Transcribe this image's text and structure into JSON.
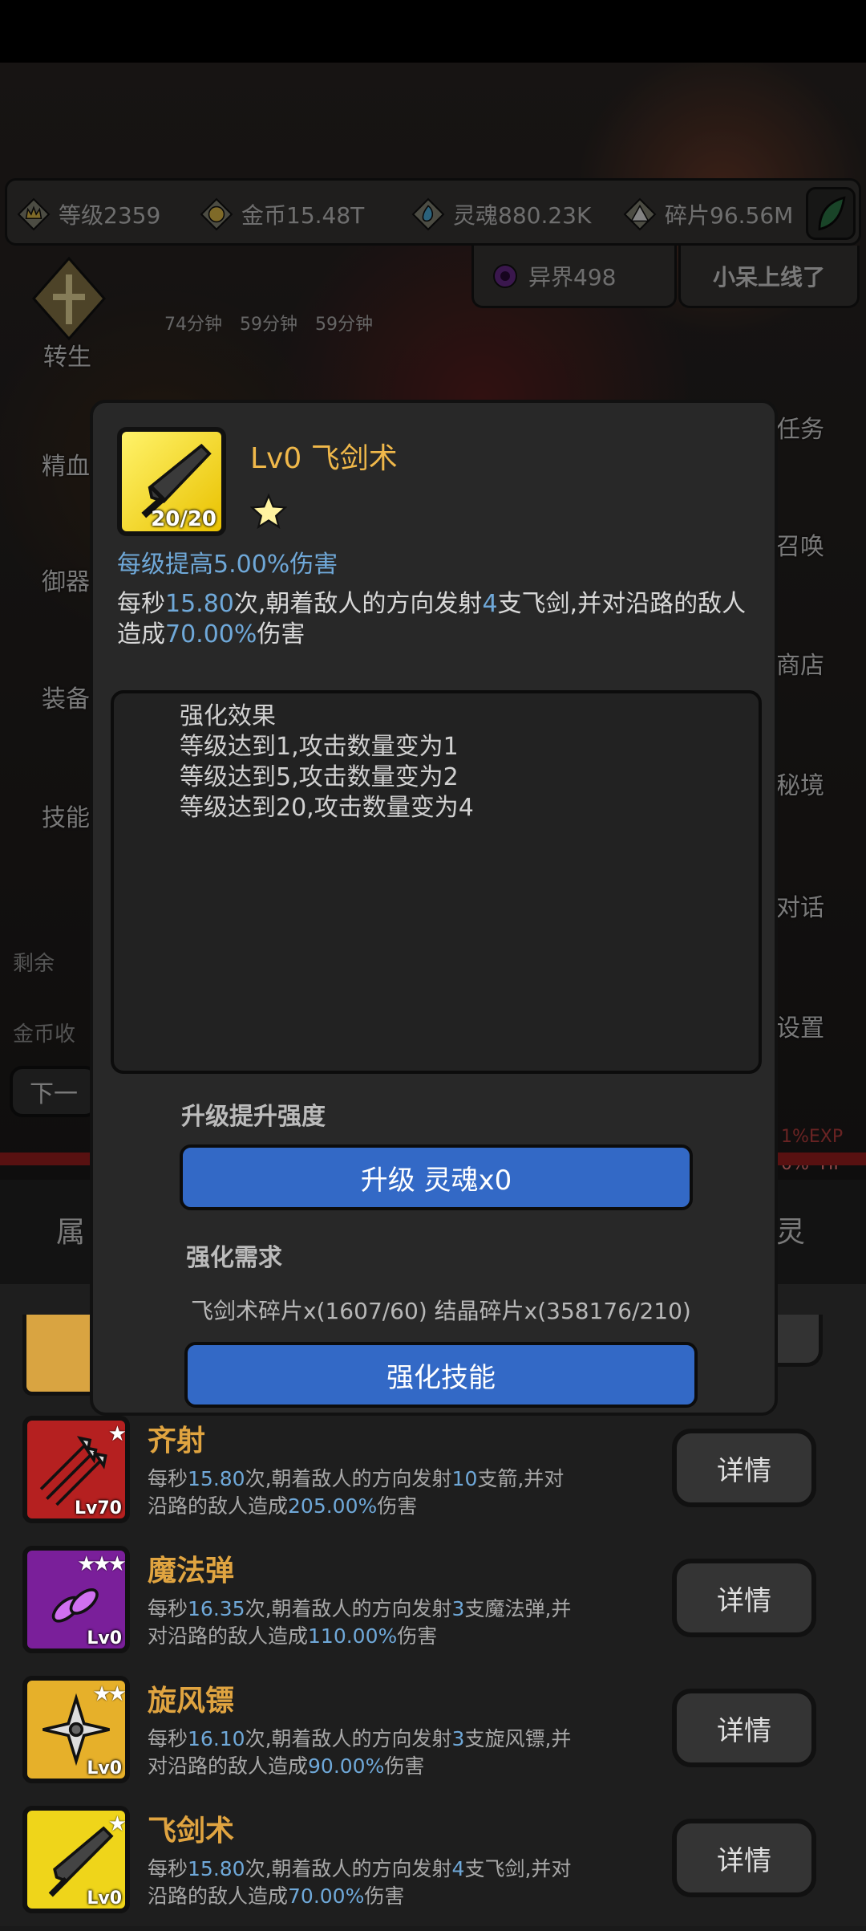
{
  "resources": {
    "level": "等级2359",
    "gold": "金币15.48T",
    "soul": "灵魂880.23K",
    "shards": "碎片96.56M",
    "otherworld": "异界498",
    "online": "小呆上线了"
  },
  "timers": [
    "74分钟",
    "59分钟",
    "59分钟"
  ],
  "left_menu": [
    "转生",
    "精血",
    "御器",
    "装备",
    "技能"
  ],
  "right_menu": [
    "任务",
    "召唤",
    "商店",
    "秘境",
    "对话",
    "设置"
  ],
  "left_info": [
    "剩余",
    "金币收"
  ],
  "next_button": "下一",
  "hud": {
    "exp": "1%EXP",
    "hp": "0%  HP"
  },
  "modal": {
    "title": "Lv0 飞剑术",
    "icon_count": "20/20",
    "growth": "每级提高5.00%伤害",
    "desc_parts": [
      "每秒",
      "15.80",
      "次,朝着敌人的方向发射",
      "4",
      "支飞剑,并对沿路的敌人造成",
      "70.00%",
      "伤害"
    ],
    "effect_title": "强化效果",
    "effects": [
      "等级达到1,攻击数量变为1",
      "等级达到5,攻击数量变为2",
      "等级达到20,攻击数量变为4"
    ],
    "upgrade_label": "升级提升强度",
    "upgrade_button": "升级 灵魂x0",
    "req_label": "强化需求",
    "req_text": "飞剑术碎片x(1607/60) 结晶碎片x(358176/210)",
    "enhance_button": "强化技能"
  },
  "tabs": {
    "left": "属",
    "right": "灵"
  },
  "skills": [
    {
      "name": "齐射",
      "level": "Lv70",
      "stars": "★",
      "desc": [
        "每秒",
        "15.80",
        "次,朝着敌人的方向发射",
        "10",
        "支箭,并对沿路的敌人造成",
        "205.00%",
        "伤害"
      ],
      "button": "详情",
      "color": "#b52020"
    },
    {
      "name": "魔法弹",
      "level": "Lv0",
      "stars": "★★★",
      "desc": [
        "每秒",
        "16.35",
        "次,朝着敌人的方向发射",
        "3",
        "支魔法弹,并对沿路的敌人造成",
        "110.00%",
        "伤害"
      ],
      "button": "详情",
      "color": "#7a1f9a"
    },
    {
      "name": "旋风镖",
      "level": "Lv0",
      "stars": "★★",
      "desc": [
        "每秒",
        "16.10",
        "次,朝着敌人的方向发射",
        "3",
        "支旋风镖,并对沿路的敌人造成",
        "90.00%",
        "伤害"
      ],
      "button": "详情",
      "color": "#e6b02a"
    },
    {
      "name": "飞剑术",
      "level": "Lv0",
      "stars": "★",
      "desc": [
        "每秒",
        "15.80",
        "次,朝着敌人的方向发射",
        "4",
        "支飞剑,并对沿路的敌人造成",
        "70.00%",
        "伤害"
      ],
      "button": "详情",
      "color": "#efd51a"
    }
  ]
}
